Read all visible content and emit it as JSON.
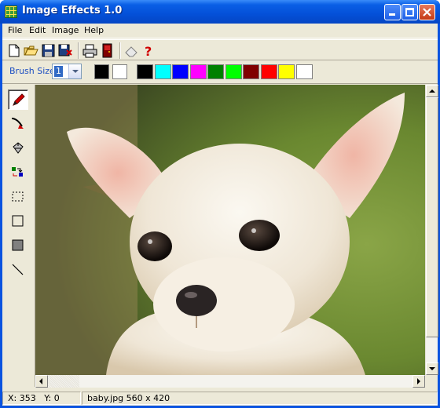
{
  "window": {
    "title": "Image Effects 1.0"
  },
  "menu": [
    "File",
    "Edit",
    "Image",
    "Help"
  ],
  "toolbar": {
    "buttons": [
      "new-file-icon",
      "open-folder-icon",
      "save-disk-icon",
      "save-as-icon",
      "print-icon",
      "exit-door-icon",
      "eraser-icon",
      "help-question-icon"
    ]
  },
  "brush": {
    "label": "Brush Size:",
    "value": "1"
  },
  "palette": {
    "primary": "#000000",
    "secondary": "#ffffff",
    "colors": [
      "#000000",
      "#00ffff",
      "#0000ff",
      "#ff00ff",
      "#008000",
      "#00ff00",
      "#800000",
      "#ff0000",
      "#ffff00",
      "#ffffff"
    ]
  },
  "tools": [
    "pencil-icon",
    "brush-curve-icon",
    "fill-bucket-icon",
    "color-swap-icon",
    "select-rect-icon",
    "rectangle-outline-icon",
    "rectangle-filled-icon",
    "line-icon"
  ],
  "status": {
    "x": "X: 353",
    "y": "Y: 0",
    "file": "baby.jpg 560 x 420"
  }
}
